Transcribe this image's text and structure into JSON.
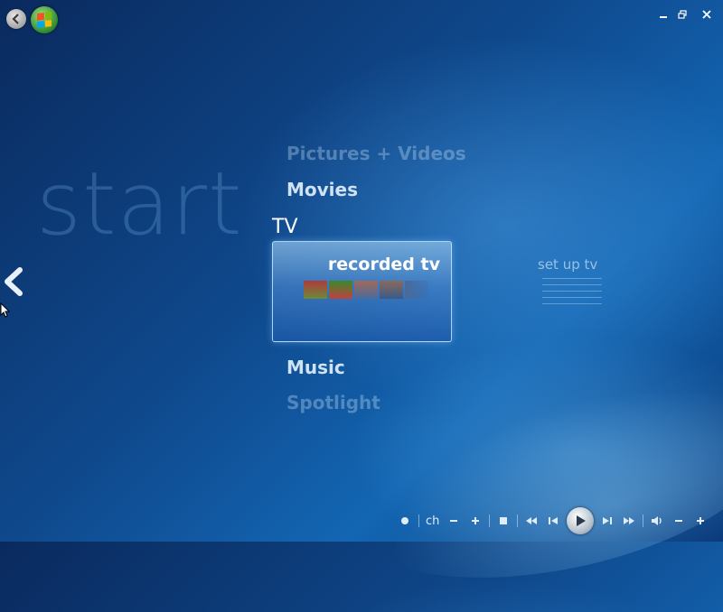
{
  "background_word": "start",
  "menu": {
    "items_above": [
      "Pictures + Videos",
      "Movies"
    ],
    "current": "TV",
    "items_below": [
      "Music",
      "Spotlight"
    ]
  },
  "tv_strip": {
    "selected": "recorded tv",
    "other": "set up tv"
  },
  "transport": {
    "channel_label": "ch"
  },
  "colors": {
    "accent": "#1366b3",
    "background_dark": "#0a2a5e",
    "text": "#cfe3f5"
  }
}
